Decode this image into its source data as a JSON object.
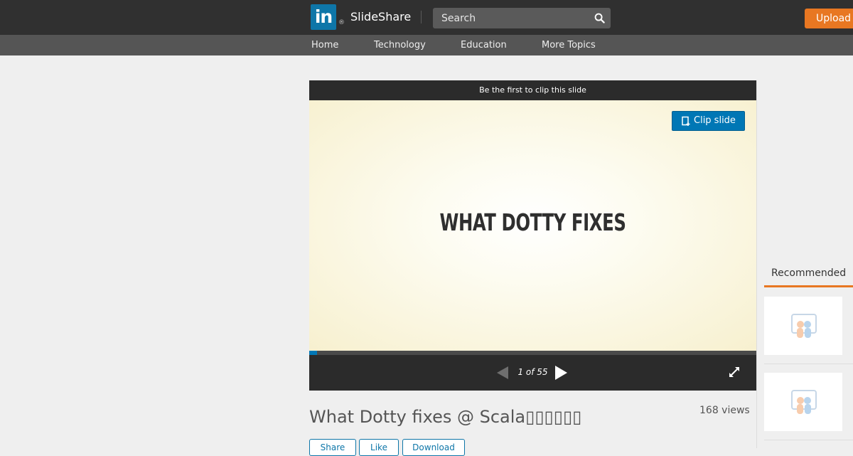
{
  "header": {
    "logo_text": "in",
    "logo_mark": "®",
    "brand": "SlideShare",
    "search": {
      "placeholder": "Search",
      "value": ""
    },
    "upload_label": "Upload"
  },
  "nav": {
    "items": [
      "Home",
      "Technology",
      "Education",
      "More Topics"
    ]
  },
  "player": {
    "clip_prompt": "Be the first to clip this slide",
    "clip_button": "Clip slide",
    "slide_text": "WHAT DOTTY FIXES",
    "counter": "1 of 55",
    "progress_fraction": 0.0182
  },
  "document": {
    "title": "What Dotty fixes @ Scala▯▯▯▯▯▯",
    "views": "168 views",
    "actions": [
      "Share",
      "Like",
      "Download"
    ]
  },
  "sidebar": {
    "recommended_label": "Recommended"
  },
  "colors": {
    "topbar": "#303030",
    "navbar": "#555555",
    "accent_orange": "#e87722",
    "linkedin_blue": "#0e76a8",
    "clip_blue": "#0077b5"
  },
  "icons": {
    "search": "search-icon",
    "clip": "clip-icon",
    "prev": "triangle-left-icon",
    "next": "triangle-right-icon",
    "fullscreen": "expand-icon"
  }
}
